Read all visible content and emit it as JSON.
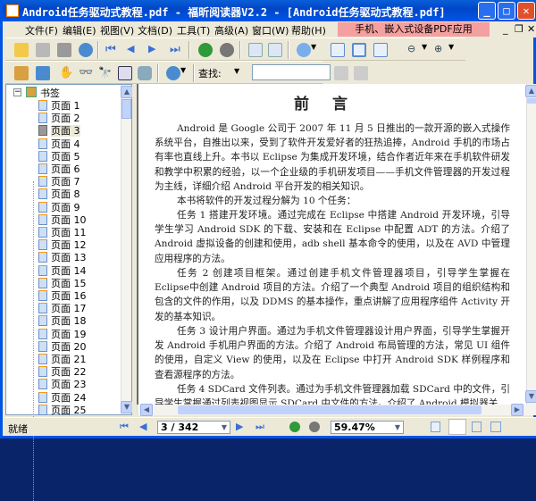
{
  "window": {
    "title": "Android任务驱动式教程.pdf - 福昕阅读器V2.2 - [Android任务驱动式教程.pdf]"
  },
  "menu": [
    "文件(F)",
    "编辑(E)",
    "视图(V)",
    "文档(D)",
    "工具(T)",
    "高级(A)",
    "窗口(W)",
    "帮助(H)"
  ],
  "ad_banner": "手机、嵌入式设备PDF应用",
  "toolbar": {
    "search_label": "查找:",
    "search_value": ""
  },
  "sidebar": {
    "root": "书签",
    "items": [
      "页面 1",
      "页面 2",
      "页面 3",
      "页面 4",
      "页面 5",
      "页面 6",
      "页面 7",
      "页面 8",
      "页面 9",
      "页面 10",
      "页面 11",
      "页面 12",
      "页面 13",
      "页面 14",
      "页面 15",
      "页面 16",
      "页面 17",
      "页面 18",
      "页面 19",
      "页面 20",
      "页面 21",
      "页面 22",
      "页面 23",
      "页面 24",
      "页面 25"
    ],
    "selected_index": 2
  },
  "document": {
    "title": "前言",
    "paragraphs": [
      "Android 是 Google 公司于 2007 年 11 月 5 日推出的一款开源的嵌入式操作系统平台，自推出以来，受到了软件开发爱好者的狂热追捧，Android 手机的市场占有率也直线上升。本书以 Eclipse 为集成开发环境，结合作者近年来在手机软件研发和教学中积累的经验，以一个企业级的手机研发项目——手机文件管理器的开发过程为主线，详细介绍 Android 平台开发的相关知识。",
      "本书将软件的开发过程分解为 10 个任务：",
      "任务 1 搭建开发环境。通过完成在 Eclipse 中搭建 Android 开发环境，引导学生学习 Android SDK 的下载、安装和在 Eclipse 中配置 ADT 的方法。介绍了 Android 虚拟设备的创建和使用，adb shell 基本命令的使用，以及在 AVD 中管理应用程序的方法。",
      "任务 2 创建项目框架。通过创建手机文件管理器项目，引导学生掌握在 Eclipse中创建 Android 项目的方法。介绍了一个典型 Android 项目的组织结构和包含的文件的作用，以及 DDMS 的基本操作，重点讲解了应用程序组件 Activity 开发的基本知识。",
      "任务 3 设计用户界面。通过为手机文件管理器设计用户界面，引导学生掌握开发 Android 手机用户界面的方法。介绍了 Android 布局管理的方法，常见 UI 组件的使用，自定义 View 的使用，以及在 Eclipse 中打开 Android SDK 样例程序和查看源程序的方法。",
      "任务 4 SDCard 文件列表。通过为手机文件管理器加载 SDCard 中的文件，引导学生掌握通过列表视图显示 SDCard 中文件的方法。介绍了 Android 模拟器关"
    ]
  },
  "status": {
    "text": "就绪",
    "page": "3 / 342",
    "zoom": "59.47%"
  }
}
